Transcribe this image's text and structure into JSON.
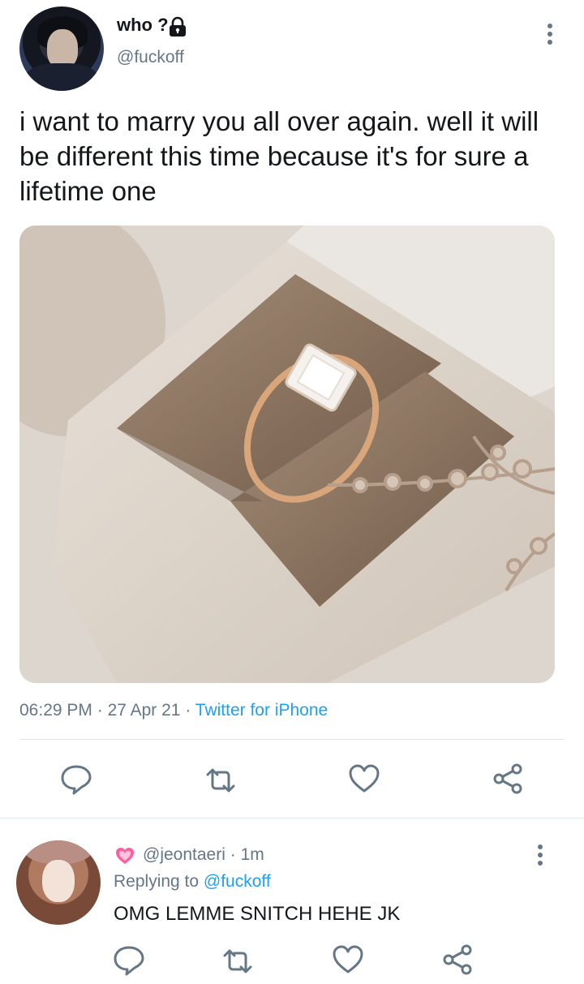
{
  "tweet": {
    "display_name": "who ?",
    "handle": "@fuckoff",
    "text": "i want to marry you all over again. well it will be different this time because it's for sure a lifetime one",
    "time": "06:29 PM",
    "date": "27 Apr 21",
    "source": "Twitter for iPhone",
    "separator": "·"
  },
  "reply": {
    "handle": "@jeontaeri",
    "age": "1m",
    "replying_prefix": "Replying to",
    "replying_to": "@fuckoff",
    "text": "OMG LEMME SNITCH HEHE JK"
  },
  "colors": {
    "text": "#14171a",
    "secondary": "#657786",
    "accent": "#1da1f2",
    "icon": "#657786",
    "divider": "#e1e8ed"
  },
  "icons": [
    "lock-icon",
    "more-icon",
    "reply-icon",
    "retweet-icon",
    "like-icon",
    "share-icon",
    "pink-heart-icon"
  ]
}
